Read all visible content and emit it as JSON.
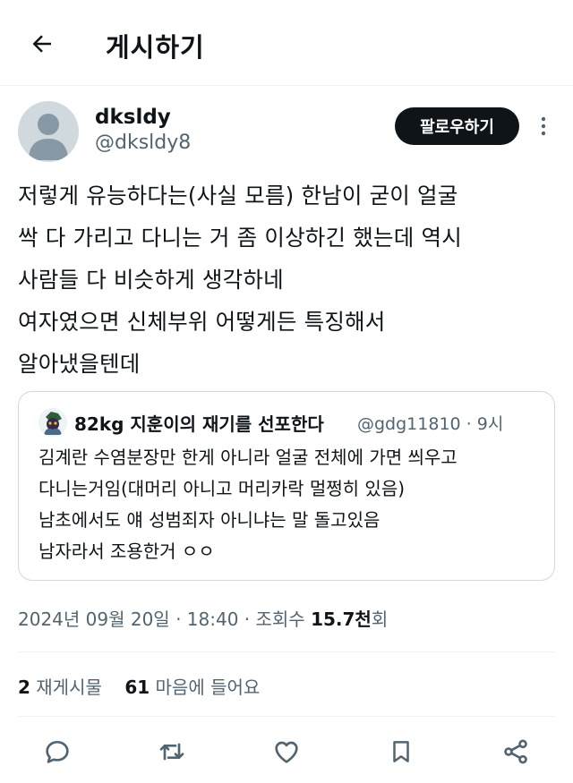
{
  "header": {
    "title": "게시하기",
    "back_icon": "arrow-left-icon"
  },
  "author": {
    "display_name": "dksldy",
    "handle": "@dksldy8",
    "follow_label": "팔로우하기"
  },
  "tweet": {
    "lines": [
      "저렇게 유능하다는(사실 모름) 한남이 굳이 얼굴",
      "싹 다 가리고 다니는 거 좀 이상하긴 했는데 역시",
      "사람들 다 비슷하게 생각하네",
      "여자였으면 신체부위 어떻게든 특징해서",
      "알아냈을텐데"
    ]
  },
  "quoted": {
    "display_name": "82kg 지훈이의 재기를 선포한다",
    "meta": "@gdg11810 · 9시",
    "lines": [
      "김계란 수염분장만 한게 아니라 얼굴 전체에 가면 씌우고",
      "다니는거임(대머리 아니고 머리카락 멀쩡히 있음)",
      "남초에서도 얘 성범죄자 아니냐는 말 돌고있음",
      "남자라서 조용한거 ㅇㅇ"
    ]
  },
  "meta": {
    "date": "2024년 09월 20일 · 18:40 · 조회수 ",
    "views_number": "15.7천",
    "views_suffix": "회"
  },
  "stats": {
    "reposts_count": "2",
    "reposts_label": " 재게시물",
    "likes_count": "61",
    "likes_label": " 마음에 들어요"
  },
  "actions": [
    "reply-icon",
    "retweet-icon",
    "heart-icon",
    "bookmark-icon",
    "share-icon"
  ]
}
